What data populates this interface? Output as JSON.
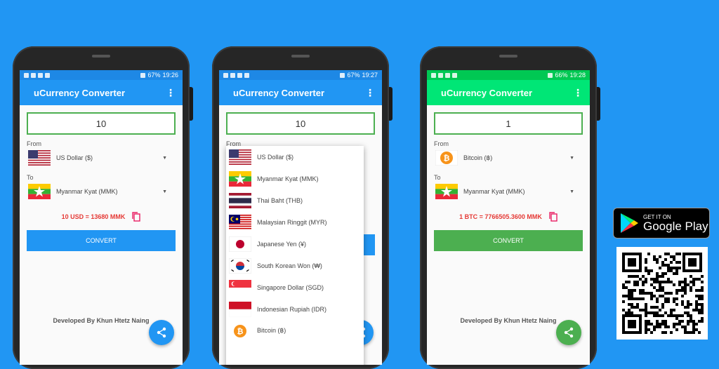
{
  "phones": [
    {
      "accent": "#2196F3",
      "green": "#4CAF50",
      "status": {
        "battery": "67%",
        "time": "19:26"
      },
      "app_title": "uCurrency Converter",
      "amount": "10",
      "from_label": "From",
      "from_currency": "US Dollar ($)",
      "to_label": "To",
      "to_currency": "Myanmar Kyat (MMK)",
      "result": "10 USD = 13680 MMK",
      "convert_label": "CONVERT",
      "footer": "Developed By Khun Htetz Naing"
    },
    {
      "accent": "#2196F3",
      "status": {
        "battery": "67%",
        "time": "19:27"
      },
      "app_title": "uCurrency Converter",
      "amount": "10",
      "from_label": "From",
      "dropdown": [
        {
          "flag": "us-flag",
          "label": "US Dollar ($)"
        },
        {
          "flag": "myanmar-flag",
          "label": "Myanmar Kyat (MMK)"
        },
        {
          "flag": "thailand-flag",
          "label": "Thai Baht (THB)"
        },
        {
          "flag": "malaysia-flag",
          "label": "Malaysian Ringgit (MYR)"
        },
        {
          "flag": "japan-flag",
          "label": "Japanese Yen (¥)"
        },
        {
          "flag": "south-korea-flag",
          "label": "South Korean Won (₩)"
        },
        {
          "flag": "singapore-flag",
          "label": "Singapore Dollar (SGD)"
        },
        {
          "flag": "indonesia-flag",
          "label": "Indonesian Rupiah (IDR)"
        },
        {
          "flag": "bitcoin-icon",
          "label": "Bitcoin (฿)"
        }
      ]
    },
    {
      "accent": "#00E676",
      "green": "#4CAF50",
      "status": {
        "battery": "66%",
        "time": "19:28"
      },
      "app_title": "uCurrency Converter",
      "amount": "1",
      "from_label": "From",
      "from_currency": "Bitcoin (฿)",
      "to_label": "To",
      "to_currency": "Myanmar Kyat (MMK)",
      "result": "1 BTC = 7766505.3600 MMK",
      "convert_label": "CONVERT",
      "footer": "Developed By Khun Htetz Naing"
    }
  ],
  "play_badge": {
    "small": "GET IT ON",
    "big": "Google Play"
  }
}
